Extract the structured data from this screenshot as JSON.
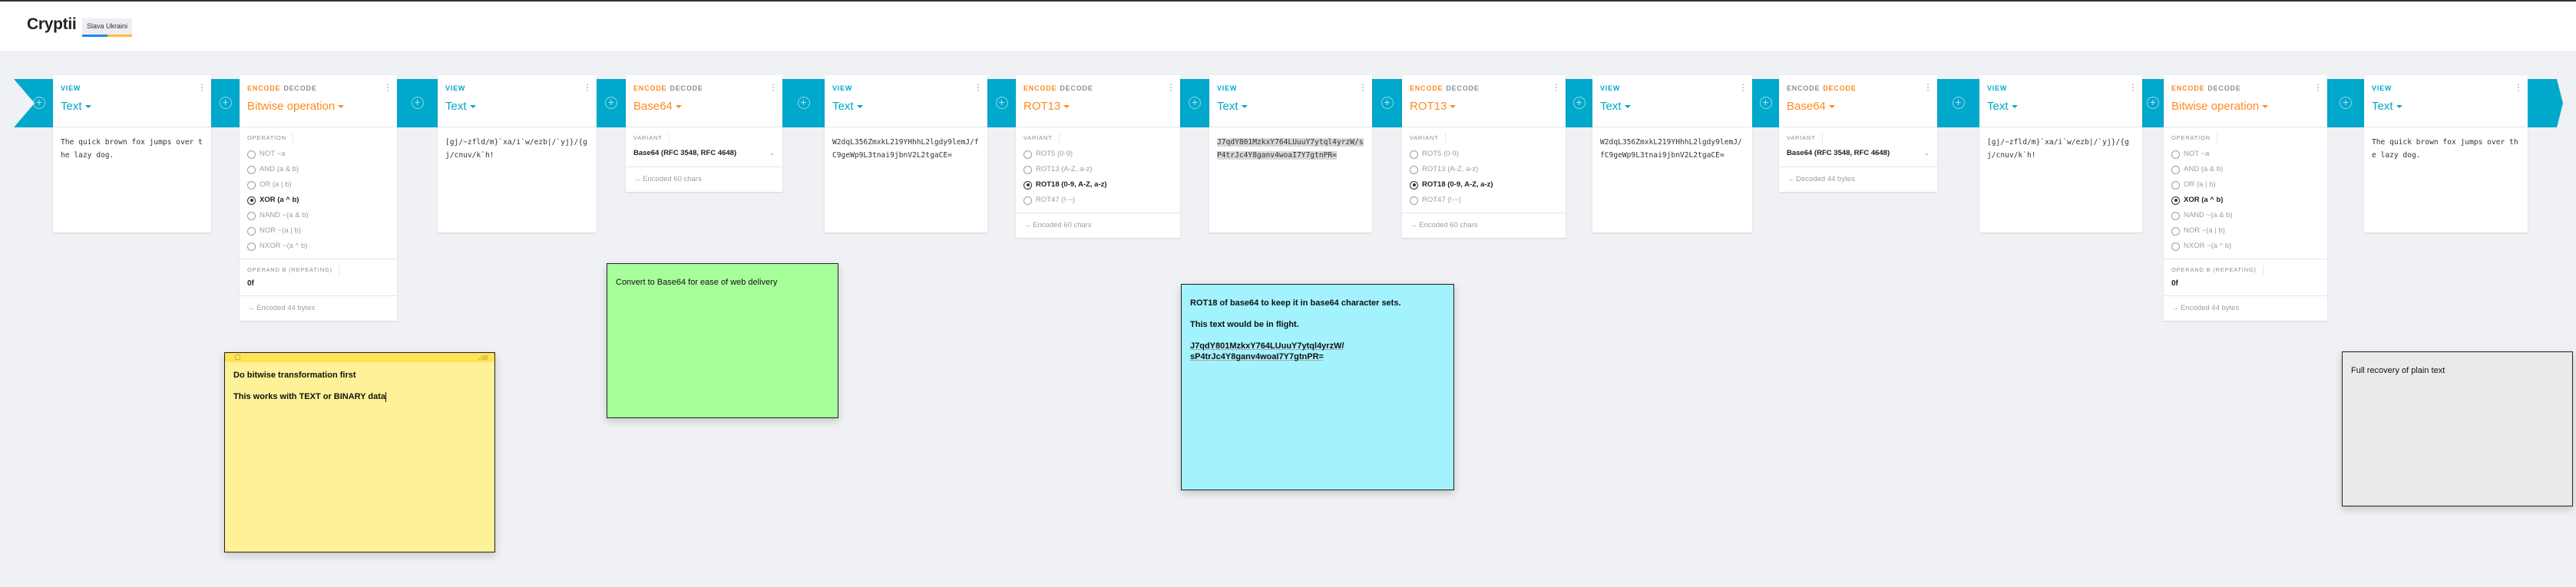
{
  "app": {
    "title": "Cryptii",
    "badge": "Slava Ukraini",
    "badge_colors": [
      "#1e88e5",
      "#fbc02d"
    ],
    "accent_view": "#00a8cc",
    "accent_op": "#ff8a1f"
  },
  "pipeline": [
    {
      "kind": "view",
      "mode": "VIEW",
      "title": "Text",
      "content": "The quick brown fox jumps over the lazy dog."
    },
    {
      "kind": "op",
      "modes": [
        "ENCODE",
        "DECODE"
      ],
      "active_mode": "ENCODE",
      "title": "Bitwise operation",
      "section_label": "OPERATION",
      "options": [
        "NOT ~a",
        "AND (a & b)",
        "OR (a | b)",
        "XOR (a ^ b)",
        "NAND ~(a & b)",
        "NOR ~(a | b)",
        "NXOR ~(a ^ b)"
      ],
      "selected": "XOR (a ^ b)",
      "operand_label": "OPERAND B (REPEATING)",
      "operand_value": "0f",
      "status": "Encoded 44 bytes"
    },
    {
      "kind": "view",
      "mode": "VIEW",
      "title": "Text",
      "content": "[gj/~zfld/m}`xa/i`w/ezb|/`yj}/{gj/cnuv/k`h!"
    },
    {
      "kind": "op",
      "modes": [
        "ENCODE",
        "DECODE"
      ],
      "active_mode": "ENCODE",
      "title": "Base64",
      "section_label": "VARIANT",
      "select_value": "Base64 (RFC 3548, RFC 4648)",
      "status": "Encoded 60 chars"
    },
    {
      "kind": "view",
      "mode": "VIEW",
      "title": "Text",
      "content": "W2dqL356ZmxkL219YHhhL2lgdy9lemJ/fC9geWp9L3tnai9jbnV2L2tgaCE="
    },
    {
      "kind": "op",
      "modes": [
        "ENCODE",
        "DECODE"
      ],
      "active_mode": "ENCODE",
      "title": "ROT13",
      "section_label": "VARIANT",
      "options": [
        "ROT5 (0-9)",
        "ROT13 (A-Z, a-z)",
        "ROT18 (0-9, A-Z, a-z)",
        "ROT47 (!-~)"
      ],
      "selected": "ROT18 (0-9, A-Z, a-z)",
      "status": "Encoded 60 chars"
    },
    {
      "kind": "view",
      "mode": "VIEW",
      "title": "Text",
      "content": "J7qdY801MzkxY764LUuuY7ytql4yrzW/sP4trJc4Y8ganv4woaI7Y7gtnPR=",
      "selected_text": true
    },
    {
      "kind": "op",
      "modes": [
        "ENCODE",
        "DECODE"
      ],
      "active_mode": "ENCODE",
      "title": "ROT13",
      "section_label": "VARIANT",
      "options": [
        "ROT5 (0-9)",
        "ROT13 (A-Z, a-z)",
        "ROT18 (0-9, A-Z, a-z)",
        "ROT47 (!-~)"
      ],
      "selected": "ROT18 (0-9, A-Z, a-z)",
      "status": "Encoded 60 chars"
    },
    {
      "kind": "view",
      "mode": "VIEW",
      "title": "Text",
      "content": "W2dqL356ZmxkL219YHhhL2lgdy9lemJ/fC9geWp9L3tnai9jbnV2L2tgaCE="
    },
    {
      "kind": "op",
      "modes": [
        "ENCODE",
        "DECODE"
      ],
      "active_mode": "DECODE",
      "title": "Base64",
      "section_label": "VARIANT",
      "select_value": "Base64 (RFC 3548, RFC 4648)",
      "status": "Decoded 44 bytes"
    },
    {
      "kind": "view",
      "mode": "VIEW",
      "title": "Text",
      "content": "[gj/~zfld/m}`xa/i`w/ezb|/`yj}/{gj/cnuv/k`h!"
    },
    {
      "kind": "op",
      "modes": [
        "ENCODE",
        "DECODE"
      ],
      "active_mode": "ENCODE",
      "title": "Bitwise operation",
      "section_label": "OPERATION",
      "options": [
        "NOT ~a",
        "AND (a & b)",
        "OR (a | b)",
        "XOR (a ^ b)",
        "NAND ~(a & b)",
        "NOR ~(a | b)",
        "NXOR ~(a ^ b)"
      ],
      "selected": "XOR (a ^ b)",
      "operand_label": "OPERAND B (REPEATING)",
      "operand_value": "0f",
      "status": "Encoded 44 bytes"
    },
    {
      "kind": "view",
      "mode": "VIEW",
      "title": "Text",
      "content": "The quick brown fox jumps over the lazy dog."
    }
  ],
  "notes": [
    {
      "id": "yellow",
      "color": "#fff197",
      "bar_color": "#ffe453",
      "lines": [
        "Do bitwise transformation first",
        "This works with TEXT or BINARY data"
      ],
      "bold": true,
      "has_cursor": true,
      "has_titlebar": true
    },
    {
      "id": "green",
      "color": "#a9fe9c",
      "lines": [
        "Convert to Base64 for ease of web delivery"
      ],
      "bold": false
    },
    {
      "id": "blue",
      "color": "#a2f3fe",
      "lines": [
        "ROT18 of base64 to keep it in base64 character sets.",
        "This text would be in flight.",
        "J7qdY801MzkxY764LUuuY7ytql4yrzW/ sP4trJc4Y8ganv4woaI7Y7gtnPR="
      ],
      "bold": true
    },
    {
      "id": "gray",
      "color": "#eaeaea",
      "lines": [
        "Full recovery of plain text"
      ],
      "bold": false
    }
  ]
}
